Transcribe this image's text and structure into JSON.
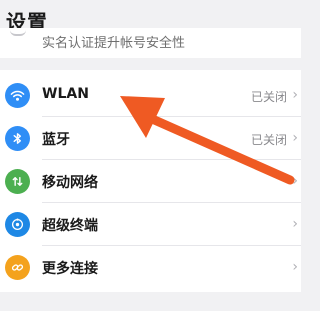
{
  "header": {
    "title": "设置"
  },
  "prev_item": {
    "text": "实名认证提升帐号安全性"
  },
  "settings": {
    "items": [
      {
        "label": "WLAN",
        "status": "已关闭",
        "icon": "wifi-icon",
        "color": "#2f8ef6"
      },
      {
        "label": "蓝牙",
        "status": "已关闭",
        "icon": "bluetooth-icon",
        "color": "#2f8ef6"
      },
      {
        "label": "移动网络",
        "status": "",
        "icon": "mobile-data-icon",
        "color": "#4caf50"
      },
      {
        "label": "超级终端",
        "status": "",
        "icon": "super-device-icon",
        "color": "#1e88e5"
      },
      {
        "label": "更多连接",
        "status": "",
        "icon": "more-connections-icon",
        "color": "#f4a21d"
      }
    ]
  },
  "annotation": {
    "arrow_color": "#ef5a23",
    "points_to": "WLAN"
  }
}
